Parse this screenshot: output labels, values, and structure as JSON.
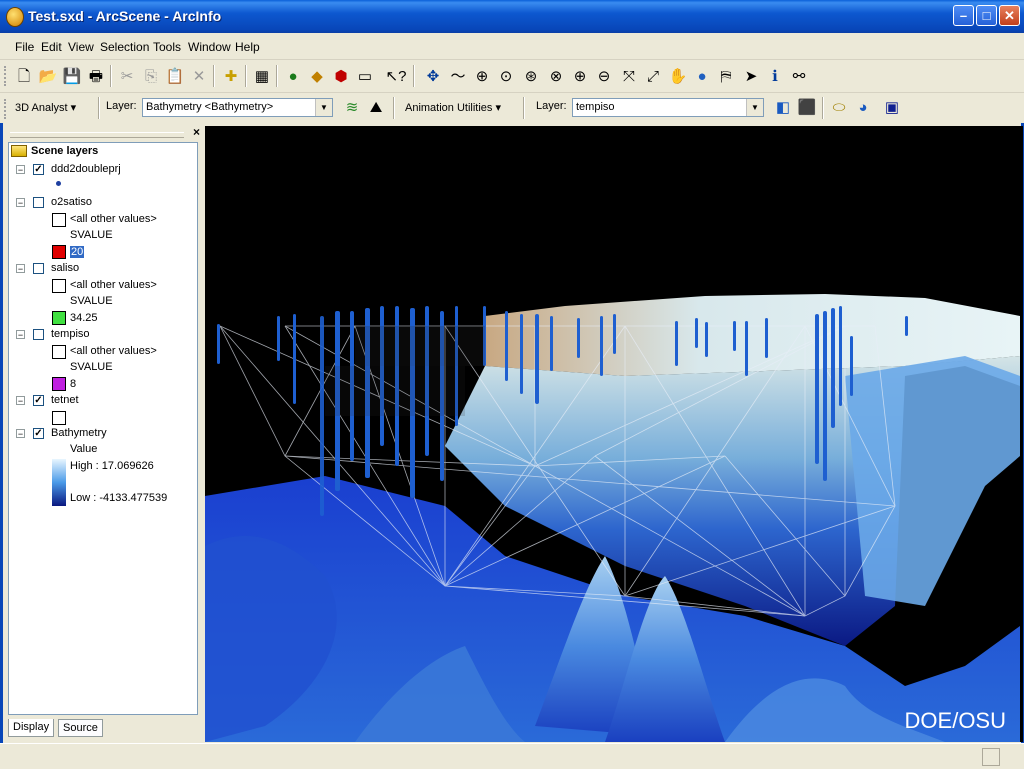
{
  "window": {
    "title": "Test.sxd - ArcScene - ArcInfo",
    "minimize_icon": "minimize-icon",
    "maximize_icon": "maximize-icon",
    "close_icon": "close-icon"
  },
  "menu": [
    "File",
    "Edit",
    "View",
    "Selection",
    "Tools",
    "Window",
    "Help"
  ],
  "toolbar_standard": {
    "icons": [
      "new-document-icon",
      "open-folder-icon",
      "save-icon",
      "print-icon",
      "cut-icon",
      "copy-icon",
      "paste-icon",
      "delete-icon",
      "add-data-icon",
      "scene-properties-icon",
      "arccatalog-icon",
      "arctoolbox-icon",
      "3d-effects-icon",
      "command-line-icon",
      "whats-this-help-icon",
      "navigate-icon",
      "fly-icon",
      "zoom-to-target-icon",
      "center-on-target-icon",
      "set-observer-icon",
      "pan-target-icon",
      "zoom-in-icon",
      "zoom-out-icon",
      "full-extent-icon",
      "zoom-extent-icon",
      "pan-hand-icon",
      "globe-icon",
      "select-features-icon",
      "select-arrow-icon",
      "identify-icon",
      "find-icon"
    ]
  },
  "toolbar_3d": {
    "analyst_label": "3D Analyst",
    "layer_label": "Layer:",
    "layer_value": "Bathymetry <Bathymetry>",
    "icons": [
      "contour-icon",
      "steepest-path-icon"
    ],
    "animation_label": "Animation Utilities",
    "layer2_label": "Layer:",
    "layer2_value": "tempiso",
    "icons2": [
      "animation-icon-1",
      "animation-icon-2",
      "animation-icon-3",
      "animation-icon-4",
      "animation-icon-5"
    ]
  },
  "toc": {
    "title": "Scene layers",
    "layers": [
      {
        "name": "ddd2doubleprj",
        "checked": true,
        "symbol": "point"
      },
      {
        "name": "o2satiso",
        "checked": false,
        "other": "<all other values>",
        "field": "SVALUE",
        "class_value": "20",
        "class_color": "#e00000"
      },
      {
        "name": "saliso",
        "checked": false,
        "other": "<all other values>",
        "field": "SVALUE",
        "class_value": "34.25",
        "class_color": "#40e040"
      },
      {
        "name": "tempiso",
        "checked": false,
        "other": "<all other values>",
        "field": "SVALUE",
        "class_value": "8",
        "class_color": "#c020e0"
      },
      {
        "name": "tetnet",
        "checked": true
      },
      {
        "name": "Bathymetry",
        "checked": true,
        "value_label": "Value",
        "high": "High : 17.069626",
        "low": "Low : -4133.477539"
      }
    ]
  },
  "tabs": [
    "Display",
    "Source"
  ],
  "scene": {
    "watermark": "DOE/OSU",
    "colors": {
      "surface_light": "#cfe8ef",
      "surface_mid": "#2f6ad8",
      "surface_dark": "#0b1a8a",
      "points": "#1e5fd0"
    }
  }
}
